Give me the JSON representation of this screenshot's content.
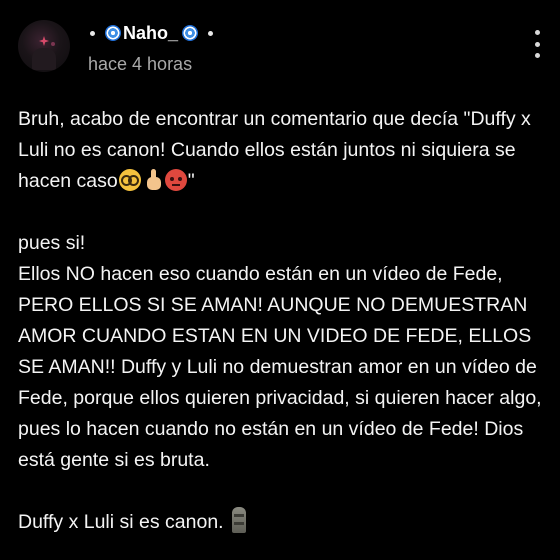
{
  "post": {
    "username": "Naho_",
    "timestamp": "hace 4 horas",
    "paragraph1_text": "Bruh, acabo de encontrar un comentario que decía \"Duffy x Luli no es canon! Cuando ellos están juntos ni siquiera se hacen caso",
    "paragraph1_end": "\"",
    "paragraph2_line1": "pues si!",
    "paragraph2_text": "Ellos NO hacen eso cuando están en un vídeo de Fede, PERO ELLOS SI SE AMAN! AUNQUE NO DEMUESTRAN AMOR CUANDO ESTAN EN UN VIDEO DE FEDE, ELLOS SE AMAN!! Duffy y Luli no demuestran amor en un vídeo de Fede, porque ellos quieren privacidad, si quieren hacer algo, pues lo hacen cuando no están en un vídeo de Fede! Dios está gente si es bruta.",
    "paragraph3_text": "Duffy x Luli si es canon."
  },
  "icons": {
    "username_decoration": "cyclone-icon",
    "menu": "more-vertical-icon",
    "emoji_1": "nerd-face-icon",
    "emoji_2": "pointing-up-icon",
    "emoji_3": "angry-face-icon",
    "emoji_4": "moai-icon"
  },
  "colors": {
    "background": "#000000",
    "text_primary": "#f4f4f4",
    "text_secondary": "#a9a9a9"
  }
}
